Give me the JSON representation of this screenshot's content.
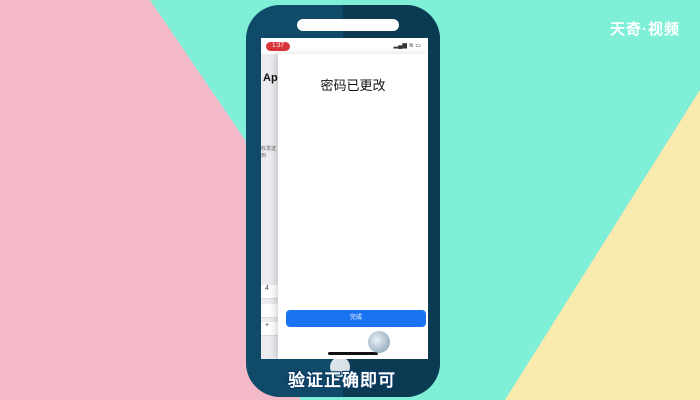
{
  "brand": "天奇·视频",
  "status": {
    "time": "1:37",
    "icons": "▂▄▆ ≋ ▭"
  },
  "under_page": {
    "title": "Ap",
    "text_lines": [
      "收发送",
      "到"
    ],
    "rows": [
      "4",
      "",
      "+"
    ]
  },
  "sheet": {
    "title": "密码已更改",
    "done_label": "完成"
  },
  "caption": "验证正确即可",
  "colors": {
    "pink": "#f4b9c9",
    "mint": "#7fefd8",
    "yellow": "#f9ebad",
    "phone": "#0f4a68",
    "button": "#1a73f0"
  }
}
